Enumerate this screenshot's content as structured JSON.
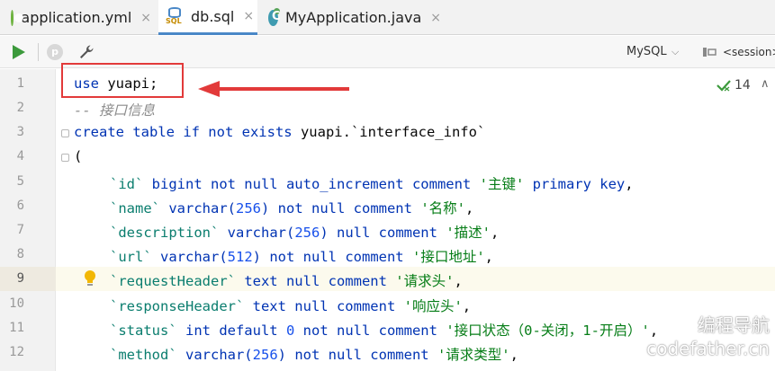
{
  "tabs": [
    {
      "label": "application.yml",
      "close": "×",
      "active": false,
      "icon": "spring-yml-icon"
    },
    {
      "label": "db.sql",
      "close": "×",
      "active": true,
      "icon": "sql-file-icon",
      "icon_text": "SQL"
    },
    {
      "label": "MyApplication.java",
      "close": "×",
      "active": false,
      "icon": "java-class-icon"
    }
  ],
  "toolbar": {
    "run_icon": "play-icon",
    "explain_icon": "p-icon",
    "explain_icon_text": "p",
    "settings_icon": "wrench-icon",
    "dialect": "MySQL",
    "dialect_chevron": "⌵",
    "session": "<session>"
  },
  "inspection": {
    "count": "14",
    "up": "∧"
  },
  "line_numbers": [
    "1",
    "2",
    "3",
    "4",
    "5",
    "6",
    "7",
    "8",
    "9",
    "10",
    "11",
    "12"
  ],
  "current_line": 9,
  "code": {
    "l1_kw": "use",
    "l1_rest": " yuapi;",
    "l2": "-- 接口信息",
    "l3_kw": "create table if not exists",
    "l3_rest": " yuapi.`interface_info`",
    "l4": "(",
    "l5_col": "`id`",
    "l5_kw": " bigint not null auto_increment comment ",
    "l5_str": "'主键'",
    "l5_kw2": " primary key",
    "l5_end": ",",
    "l6_col": "`name`",
    "l6_kw": " varchar(",
    "l6_num": "256",
    "l6_kw2": ") not null comment ",
    "l6_str": "'名称'",
    "l6_end": ",",
    "l7_col": "`description`",
    "l7_kw": " varchar(",
    "l7_num": "256",
    "l7_kw2": ") null comment ",
    "l7_str": "'描述'",
    "l7_end": ",",
    "l8_col": "`url`",
    "l8_kw": " varchar(",
    "l8_num": "512",
    "l8_kw2": ") not null comment ",
    "l8_str": "'接口地址'",
    "l8_end": ",",
    "l9_col": "`requestHeader`",
    "l9_kw": " text null comment ",
    "l9_str": "'请求头'",
    "l9_end": ",",
    "l10_col": "`responseHeader`",
    "l10_kw": " text null comment ",
    "l10_str": "'响应头'",
    "l10_end": ",",
    "l11_col": "`status`",
    "l11_kw": " int default ",
    "l11_num": "0",
    "l11_kw2": " not null comment ",
    "l11_str": "'接口状态（0-关闭，1-开启）'",
    "l11_end": ",",
    "l12_col": "`method`",
    "l12_kw": " varchar(",
    "l12_num": "256",
    "l12_kw2": ") not null comment ",
    "l12_str": "'请求类型'",
    "l12_end": ","
  },
  "watermark": {
    "line1": "编程导航",
    "line2": "codefather.cn"
  },
  "colors": {
    "keyword": "#0033b3",
    "string": "#067d17",
    "number": "#1750eb",
    "comment": "#8c8c8c",
    "annotation": "#e23a3a",
    "active_tab": "#4a88c7"
  }
}
